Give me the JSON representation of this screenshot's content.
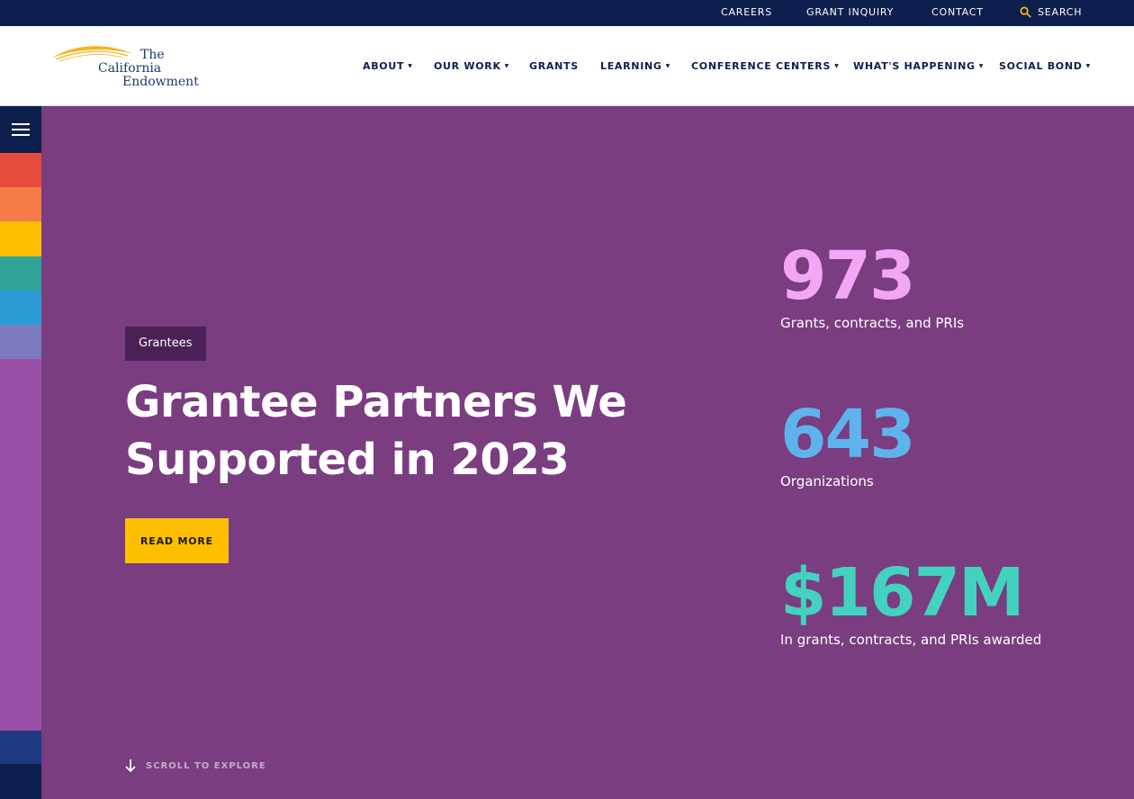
{
  "utility_nav": {
    "careers": "CAREERS",
    "grant_inquiry": "GRANT INQUIRY",
    "contact": "CONTACT",
    "search": "SEARCH"
  },
  "logo": {
    "line1": "The",
    "line2": "California",
    "line3": "Endowment"
  },
  "main_nav": [
    {
      "label": "ABOUT",
      "has_dropdown": true
    },
    {
      "label": "OUR WORK",
      "has_dropdown": true
    },
    {
      "label": "GRANTS",
      "has_dropdown": false
    },
    {
      "label": "LEARNING",
      "has_dropdown": true
    },
    {
      "label": "CONFERENCE CENTERS",
      "has_dropdown": true
    },
    {
      "label": "WHAT'S HAPPENING",
      "has_dropdown": true
    },
    {
      "label": "SOCIAL BOND",
      "has_dropdown": true
    }
  ],
  "dropdown_caret": "▼",
  "rail_colors": [
    "#e64b3b",
    "#f47b45",
    "#ffbf00",
    "#2fa398",
    "#2b9bd6",
    "#7b7abf",
    "#9a4fa6",
    "#1b3a80",
    "#0d1f4c"
  ],
  "hero": {
    "tag": "Grantees",
    "title": "Grantee Partners We Supported in 2023",
    "cta": "READ MORE",
    "scroll_hint": "SCROLL TO EXPLORE",
    "background_color": "#7a3d80"
  },
  "stats": [
    {
      "value": "973",
      "label": "Grants, contracts, and PRIs",
      "color": "#f2a6f4"
    },
    {
      "value": "643",
      "label": "Organizations",
      "color": "#5fb3ec"
    },
    {
      "value": "$167M",
      "label": "In grants, contracts, and PRIs awarded",
      "color": "#44d2c0"
    }
  ],
  "icons": {
    "search": "search-icon",
    "menu": "hamburger-menu-icon",
    "scroll": "arrow-down-icon"
  }
}
